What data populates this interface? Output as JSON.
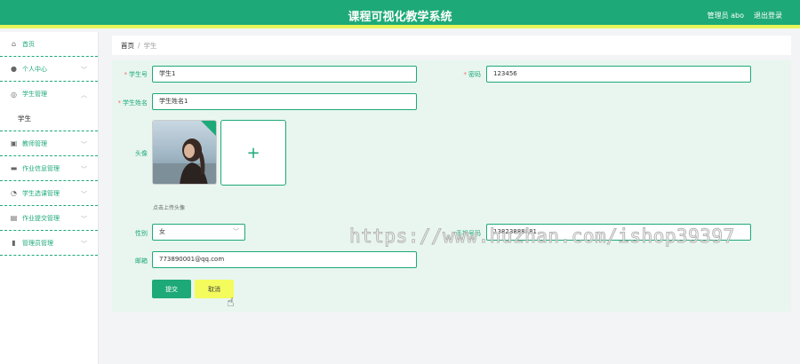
{
  "app": {
    "title": "课程可视化教学系统",
    "user_label": "管理员 abo",
    "logout_label": "退出登录"
  },
  "sidebar": {
    "items": [
      {
        "label": "首页",
        "icon": "home-icon"
      },
      {
        "label": "个人中心",
        "icon": "user-icon"
      },
      {
        "label": "学生管理",
        "icon": "compass-icon"
      },
      {
        "label": "学生",
        "icon": ""
      },
      {
        "label": "教师管理",
        "icon": "id-card-icon"
      },
      {
        "label": "作业信息管理",
        "icon": "briefcase-icon"
      },
      {
        "label": "学生选课管理",
        "icon": "clock-icon"
      },
      {
        "label": "作业提交管理",
        "icon": "print-icon"
      },
      {
        "label": "管理员管理",
        "icon": "chart-icon"
      }
    ]
  },
  "breadcrumb": {
    "home": "首页",
    "separator": "/",
    "current": "学生"
  },
  "form": {
    "student_id_label": "学生号",
    "student_id_value": "学生1",
    "password_label": "密码",
    "password_value": "123456",
    "name_label": "学生姓名",
    "name_value": "学生姓名1",
    "avatar_label": "头像",
    "upload_hint": "点击上传头像",
    "gender_label": "性别",
    "gender_value": "女",
    "phone_label": "手机号码",
    "phone_value": "13823888881",
    "email_label": "邮箱",
    "email_value": "773890001@qq.com",
    "submit_label": "提交",
    "cancel_label": "取消"
  },
  "watermark": "https://www.huzhan.com/ishop39397",
  "colors": {
    "primary": "#1ea978",
    "accent_bar": "#e8f55a",
    "panel_bg": "#e8f6ef",
    "cancel_bg": "#f4fb5c",
    "required": "#f56c6c"
  }
}
